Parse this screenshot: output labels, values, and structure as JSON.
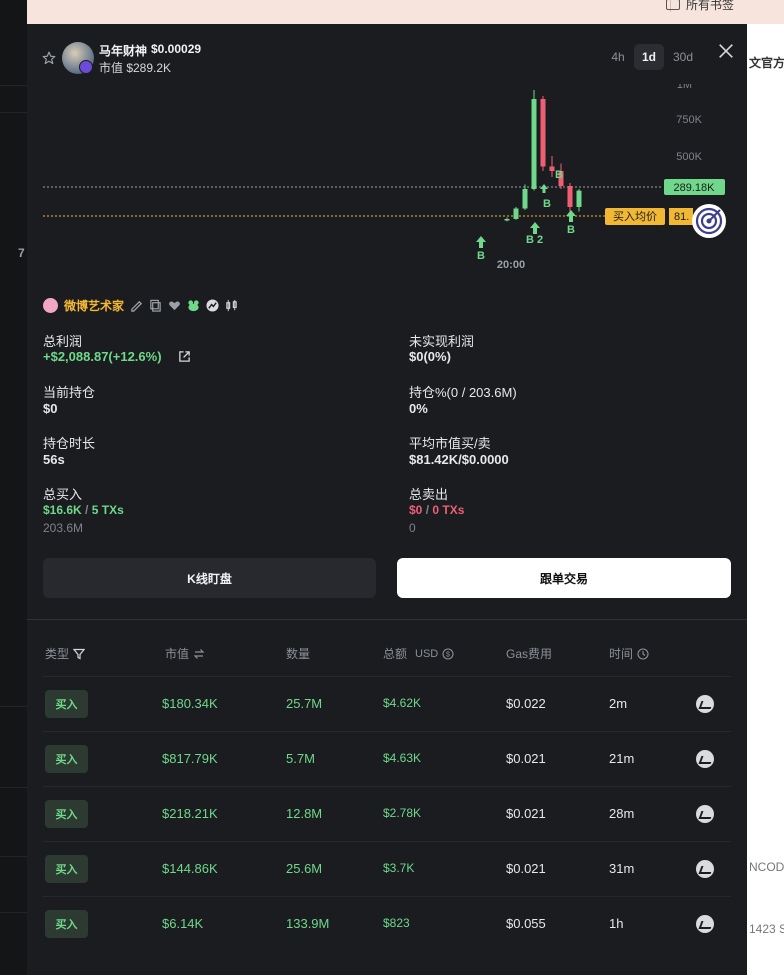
{
  "browser": {
    "bookmark_label": "所有书签"
  },
  "background": {
    "left_number": "7",
    "right_fragments": [
      "文官方",
      "NCOD",
      "1423 S"
    ]
  },
  "token": {
    "name": "马年财神",
    "price": "$0.00029",
    "mcap_label": "市值 $289.2K"
  },
  "timeframes": [
    {
      "label": "4h",
      "active": false
    },
    {
      "label": "1d",
      "active": true
    },
    {
      "label": "30d",
      "active": false
    }
  ],
  "chart_data": {
    "type": "candlestick",
    "y_tick_labels": [
      "1M",
      "750K",
      "500K"
    ],
    "x_tick_labels": [
      "20:00"
    ],
    "current_mcap_label": "289.18K",
    "avg_buy_label": "买入均价",
    "avg_buy_value": "81.",
    "trade_markers": [
      "B",
      "B 2",
      "B",
      "B",
      "B"
    ],
    "colors": {
      "up": "#6fd88a",
      "down": "#ef5f74",
      "avg_line": "#f2b733",
      "current_line": "#9aa0a8"
    },
    "candles": [
      {
        "o": 90,
        "h": 110,
        "l": 85,
        "c": 100
      },
      {
        "o": 100,
        "h": 180,
        "l": 95,
        "c": 170
      },
      {
        "o": 170,
        "h": 330,
        "l": 160,
        "c": 300
      },
      {
        "o": 300,
        "h": 960,
        "l": 290,
        "c": 900
      },
      {
        "o": 900,
        "h": 920,
        "l": 420,
        "c": 450
      },
      {
        "o": 450,
        "h": 520,
        "l": 380,
        "c": 420
      },
      {
        "o": 420,
        "h": 470,
        "l": 300,
        "c": 320
      },
      {
        "o": 320,
        "h": 340,
        "l": 150,
        "c": 180
      },
      {
        "o": 180,
        "h": 300,
        "l": 150,
        "c": 289
      }
    ]
  },
  "trader": {
    "nickname": "微博艺术家"
  },
  "stats": {
    "total_profit_label": "总利润",
    "total_profit_value": "+$2,088.87(+12.6%)",
    "unrealized_label": "未实现利润",
    "unrealized_value": "$0(0%)",
    "holding_label": "当前持仓",
    "holding_value": "$0",
    "holding_pct_label": "持仓%(0 / 203.6M)",
    "holding_pct_value": "0%",
    "duration_label": "持仓时长",
    "duration_value": "56s",
    "avg_mcap_label": "平均市值买/卖",
    "avg_mcap_value": "$81.42K/$0.0000",
    "total_buy_label": "总买入",
    "total_buy_amount": "$16.6K",
    "total_buy_sep": "/",
    "total_buy_txs": "5 TXs",
    "total_buy_qty": "203.6M",
    "total_sell_label": "总卖出",
    "total_sell_amount": "$0",
    "total_sell_sep": "/",
    "total_sell_txs": "0 TXs",
    "total_sell_qty": "0"
  },
  "buttons": {
    "kline": "K线盯盘",
    "copy_trade": "跟单交易"
  },
  "table": {
    "headers": {
      "type": "类型",
      "mcap": "市值",
      "qty": "数量",
      "total": "总额",
      "total_unit": "USD",
      "gas": "Gas费用",
      "time": "时间"
    },
    "rows": [
      {
        "type": "买入",
        "mcap": "$180.34K",
        "qty": "25.7M",
        "total": "$4.62K",
        "gas": "$0.022",
        "time": "2m"
      },
      {
        "type": "买入",
        "mcap": "$817.79K",
        "qty": "5.7M",
        "total": "$4.63K",
        "gas": "$0.021",
        "time": "21m"
      },
      {
        "type": "买入",
        "mcap": "$218.21K",
        "qty": "12.8M",
        "total": "$2.78K",
        "gas": "$0.021",
        "time": "28m"
      },
      {
        "type": "买入",
        "mcap": "$144.86K",
        "qty": "25.6M",
        "total": "$3.7K",
        "gas": "$0.021",
        "time": "31m"
      },
      {
        "type": "买入",
        "mcap": "$6.14K",
        "qty": "133.9M",
        "total": "$823",
        "gas": "$0.055",
        "time": "1h"
      }
    ]
  }
}
